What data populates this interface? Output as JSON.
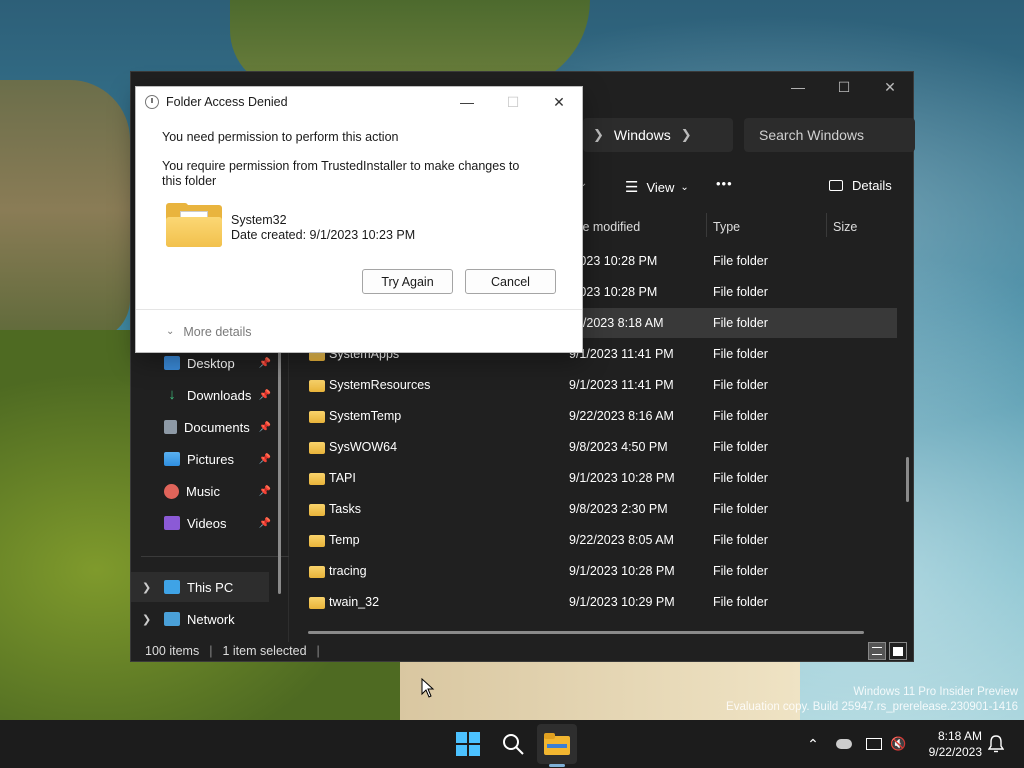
{
  "desktop": {
    "watermark_line1": "Windows 11 Pro Insider Preview",
    "watermark_line2": "Evaluation copy. Build 25947.rs_prerelease.230901-1416"
  },
  "explorer": {
    "address_current": "Windows",
    "search_placeholder": "Search Windows",
    "toolbar": {
      "view_label": "View",
      "more_label": "•••",
      "details_label": "Details"
    },
    "columns": {
      "date": "te modified",
      "type": "Type",
      "size": "Size"
    },
    "nav_items": [
      {
        "label": "Desktop",
        "icon": "desktop-icon",
        "color": "#3a8ad8"
      },
      {
        "label": "Downloads",
        "icon": "download-icon",
        "color": "#3fbf7f"
      },
      {
        "label": "Documents",
        "icon": "document-icon",
        "color": "#8e9aa6"
      },
      {
        "label": "Pictures",
        "icon": "picture-icon",
        "color": "#2f8fe0"
      },
      {
        "label": "Music",
        "icon": "music-icon",
        "color": "#e0645a"
      },
      {
        "label": "Videos",
        "icon": "video-icon",
        "color": "#8b5ad6"
      }
    ],
    "nav_bottom": [
      {
        "label": "This PC",
        "icon": "pc-icon"
      },
      {
        "label": "Network",
        "icon": "network-icon"
      }
    ],
    "files": [
      {
        "name": "",
        "date": "/2023 10:28 PM",
        "type": "File folder"
      },
      {
        "name": "",
        "date": "/2023 10:28 PM",
        "type": "File folder"
      },
      {
        "name": "",
        "date": "22/2023 8:18 AM",
        "type": "File folder"
      },
      {
        "name": "SystemApps",
        "date": "9/1/2023 11:41 PM",
        "type": "File folder"
      },
      {
        "name": "SystemResources",
        "date": "9/1/2023 11:41 PM",
        "type": "File folder"
      },
      {
        "name": "SystemTemp",
        "date": "9/22/2023 8:16 AM",
        "type": "File folder"
      },
      {
        "name": "SysWOW64",
        "date": "9/8/2023 4:50 PM",
        "type": "File folder"
      },
      {
        "name": "TAPI",
        "date": "9/1/2023 10:28 PM",
        "type": "File folder"
      },
      {
        "name": "Tasks",
        "date": "9/8/2023 2:30 PM",
        "type": "File folder"
      },
      {
        "name": "Temp",
        "date": "9/22/2023 8:05 AM",
        "type": "File folder"
      },
      {
        "name": "tracing",
        "date": "9/1/2023 10:28 PM",
        "type": "File folder"
      },
      {
        "name": "twain_32",
        "date": "9/1/2023 10:29 PM",
        "type": "File folder"
      }
    ],
    "status": {
      "items": "100 items",
      "selected": "1 item selected"
    }
  },
  "dialog": {
    "title": "Folder Access Denied",
    "message1": "You need permission to perform this action",
    "message2": "You require permission from TrustedInstaller to make changes to this folder",
    "folder_name": "System32",
    "folder_date": "Date created: 9/1/2023 10:23 PM",
    "try_again": "Try Again",
    "cancel": "Cancel",
    "more_details": "More details"
  },
  "taskbar": {
    "time": "8:18 AM",
    "date": "9/22/2023"
  }
}
